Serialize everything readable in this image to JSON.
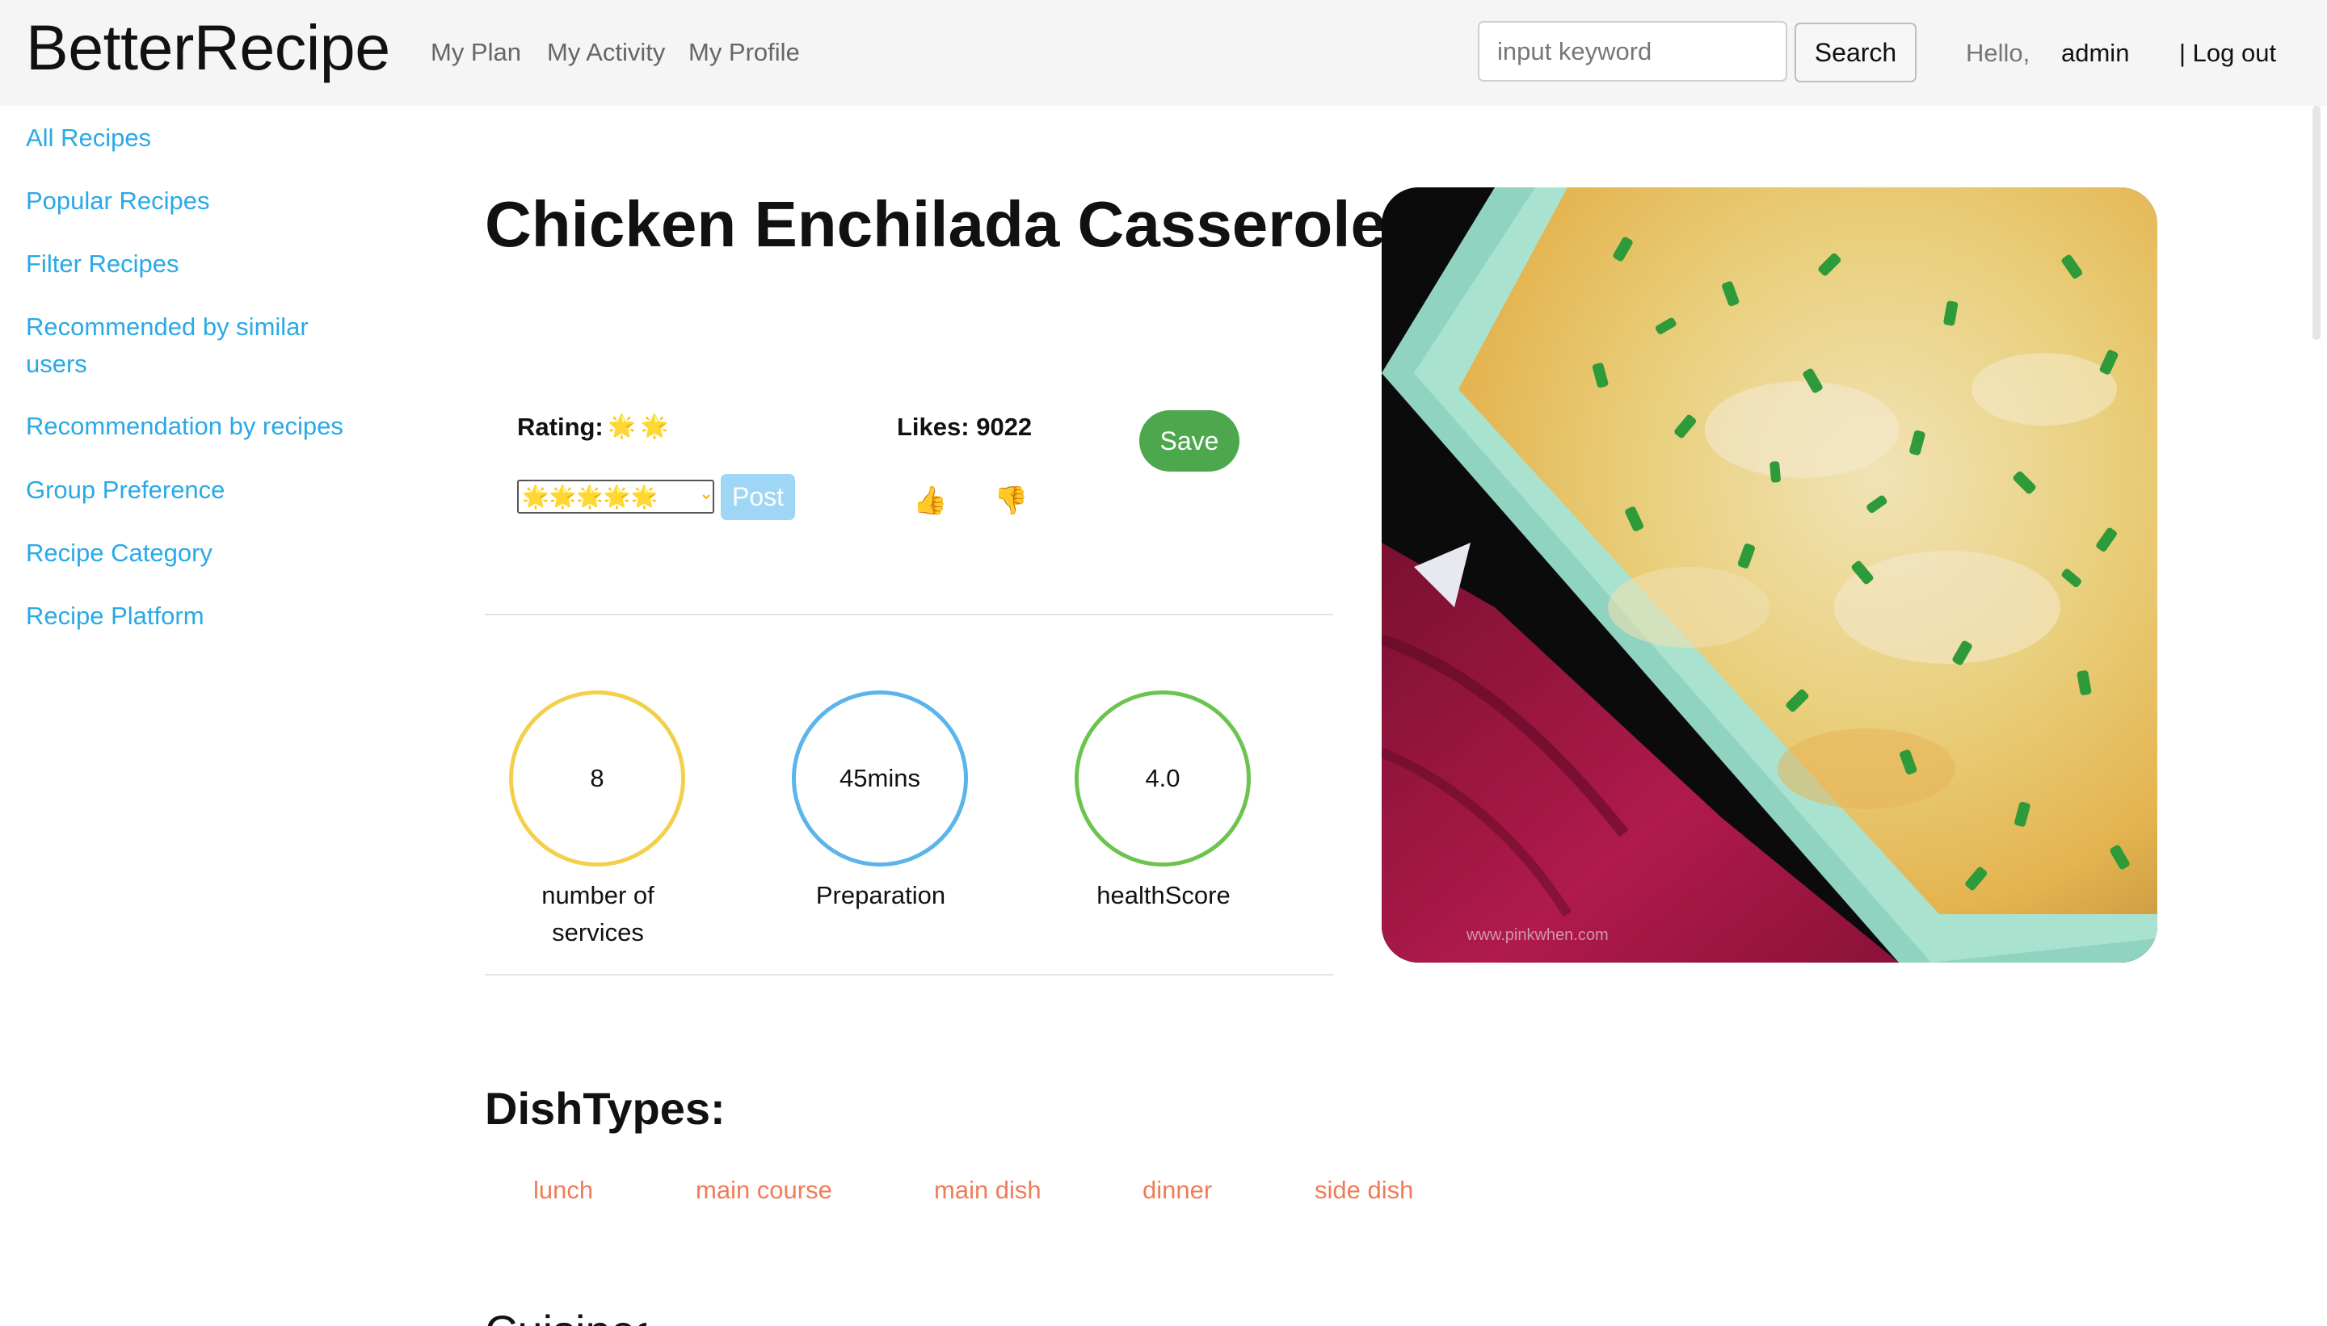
{
  "navbar": {
    "brand": "BetterRecipe",
    "links": [
      "My Plan",
      "My Activity",
      "My Profile"
    ],
    "search_placeholder": "input keyword",
    "search_value": "",
    "search_button": "Search",
    "greeting": "Hello,",
    "username": "admin",
    "logout": "| Log out"
  },
  "sidebar": {
    "items": [
      "All Recipes",
      "Popular Recipes",
      "Filter Recipes",
      "Recommended by similar users",
      "Recommendation by recipes",
      "Group Preference",
      "Recipe Category",
      "Recipe Platform"
    ]
  },
  "recipe": {
    "title": "Chicken Enchilada Casserole",
    "rating_label": "Rating:",
    "rating_value": 2,
    "rating_stars": "🌟🌟",
    "rating_select_value": "🌟🌟🌟🌟🌟",
    "rating_options": [
      "🌟🌟🌟🌟🌟"
    ],
    "post_button": "Post",
    "likes_label": "Likes: 9022",
    "like_icon": "thumbs-up-icon",
    "dislike_icon": "thumbs-down-icon",
    "like_glyph": "👍",
    "dislike_glyph": "👎",
    "save_button": "Save",
    "image_watermark": "www.pinkwhen.com"
  },
  "stats": [
    {
      "value": "8",
      "label": "number of services",
      "color": "#f2d04c"
    },
    {
      "value": "45mins",
      "label": "Preparation",
      "color": "#5bb4ea"
    },
    {
      "value": "4.0",
      "label": "healthScore",
      "color": "#6cc44f"
    }
  ],
  "dish_types": {
    "heading": "DishTypes:",
    "items": [
      "lunch",
      "main course",
      "main dish",
      "dinner",
      "side dish"
    ],
    "color": "#f07c57"
  },
  "next_section_heading": "Cuisines:",
  "colors": {
    "navbar_bg": "#f5f5f5",
    "link": "#29a9e6",
    "save_green": "#4da84d",
    "post_blue": "#9fd6f6"
  }
}
